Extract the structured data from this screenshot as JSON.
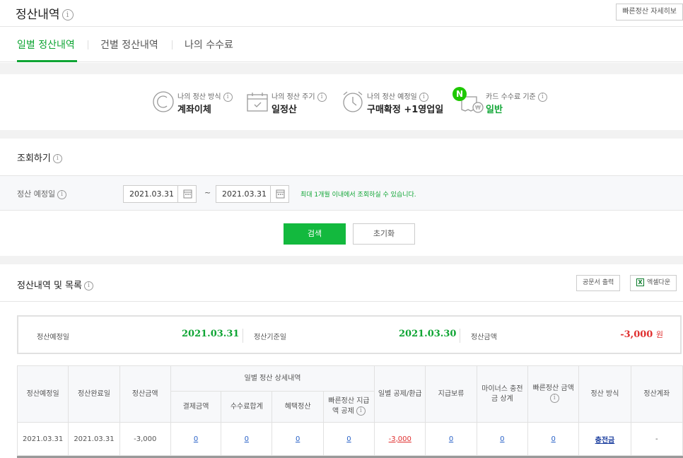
{
  "header": {
    "title": "정산내역",
    "guide_button": "빠른정산 자세히보"
  },
  "tabs": [
    {
      "label": "일별 정산내역",
      "active": true
    },
    {
      "label": "건별 정산내역",
      "active": false
    },
    {
      "label": "나의 수수료",
      "active": false
    }
  ],
  "summary": {
    "method": {
      "label": "나의 정산 방식",
      "value": "계좌이체",
      "icon": "c-circle-icon"
    },
    "cycle": {
      "label": "나의 정산 주기",
      "value": "일정산",
      "icon": "calendar-icon"
    },
    "schedule": {
      "label": "나의 정산 예정일",
      "value": "구매확정 +1영업일",
      "icon": "clock-icon"
    },
    "card_fee": {
      "label": "카드 수수료 기준",
      "value": "일반",
      "icon": "receipt-won-icon",
      "badge": "N"
    }
  },
  "search": {
    "title": "조회하기",
    "row_label": "정산 예정일",
    "start_date": "2021.03.31",
    "end_date": "2021.03.31",
    "separator": "~",
    "hint": "최대 1개월 이내에서 조회하실 수 있습니다.",
    "search_button": "검색",
    "reset_button": "초기화"
  },
  "list": {
    "title": "정산내역 및 목록",
    "print_button": "공문서 출력",
    "excel_button": "엑셀다운",
    "excel_icon_char": "X"
  },
  "totals": {
    "scheduled_date_label": "정산예정일",
    "scheduled_date": "2021.03.31",
    "base_date_label": "정산기준일",
    "base_date": "2021.03.30",
    "amount_label": "정산금액",
    "amount": "-3,000",
    "amount_unit": "원"
  },
  "table": {
    "headers": {
      "scheduled_date": "정산예정일",
      "completed_date": "정산완료일",
      "amount": "정산금액",
      "detail_group": "일별 정산 상세내역",
      "payment": "결제금액",
      "fee_total": "수수료합계",
      "benefit": "혜택정산",
      "quick_deduct": "빠른정산 지급액 공제",
      "daily_deduct": "일별 공제/환급",
      "hold": "지급보류",
      "minus_charge": "마이너스 충전금 상계",
      "quick_amount": "빠른정산 금액",
      "method": "정산 방식",
      "account": "정산계좌"
    },
    "rows": [
      {
        "scheduled_date": "2021.03.31",
        "completed_date": "2021.03.31",
        "amount": "-3,000",
        "payment": "0",
        "fee_total": "0",
        "benefit": "0",
        "quick_deduct": "0",
        "daily_deduct": "-3,000",
        "hold": "0",
        "minus_charge": "0",
        "quick_amount": "0",
        "method": "충전금",
        "account": "-"
      }
    ]
  },
  "colors": {
    "accent_green": "#0fa534",
    "button_green": "#13b93e",
    "negative_red": "#e03030",
    "link_blue": "#2962c8"
  }
}
